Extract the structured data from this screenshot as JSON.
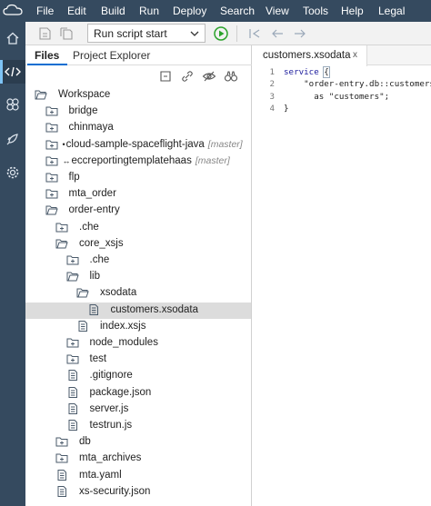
{
  "menu": [
    "File",
    "Edit",
    "Build",
    "Run",
    "Deploy",
    "Search",
    "View",
    "Tools",
    "Help",
    "Legal"
  ],
  "toolbar": {
    "run_config": "Run script start"
  },
  "panel": {
    "tabs": [
      "Files",
      "Project Explorer"
    ]
  },
  "tree": [
    {
      "label": "Workspace",
      "type": "folder-open",
      "depth": 0
    },
    {
      "label": "bridge",
      "type": "folder-pkg",
      "depth": 1
    },
    {
      "label": "chinmaya",
      "type": "folder-pkg",
      "depth": 1
    },
    {
      "label": "cloud-sample-spaceflight-java",
      "type": "folder-pkg",
      "depth": 1,
      "prefix": "•",
      "tag": "[master]"
    },
    {
      "label": "eccreportingtemplatehaas",
      "type": "folder-pkg",
      "depth": 1,
      "prefix": "↔",
      "tag": "[master]"
    },
    {
      "label": "flp",
      "type": "folder-pkg",
      "depth": 1
    },
    {
      "label": "mta_order",
      "type": "folder-pkg",
      "depth": 1
    },
    {
      "label": "order-entry",
      "type": "folder-open",
      "depth": 1
    },
    {
      "label": ".che",
      "type": "folder-pkg",
      "depth": 2
    },
    {
      "label": "core_xsjs",
      "type": "folder-open",
      "depth": 2
    },
    {
      "label": ".che",
      "type": "folder-pkg",
      "depth": 3
    },
    {
      "label": "lib",
      "type": "folder-open",
      "depth": 3
    },
    {
      "label": "xsodata",
      "type": "folder-open",
      "depth": 4
    },
    {
      "label": "customers.xsodata",
      "type": "file",
      "depth": 5,
      "selected": true
    },
    {
      "label": "index.xsjs",
      "type": "file",
      "depth": 4
    },
    {
      "label": "node_modules",
      "type": "folder-pkg",
      "depth": 3
    },
    {
      "label": "test",
      "type": "folder-pkg",
      "depth": 3
    },
    {
      "label": ".gitignore",
      "type": "file",
      "depth": 3
    },
    {
      "label": "package.json",
      "type": "file",
      "depth": 3
    },
    {
      "label": "server.js",
      "type": "file",
      "depth": 3
    },
    {
      "label": "testrun.js",
      "type": "file",
      "depth": 3
    },
    {
      "label": "db",
      "type": "folder-pkg",
      "depth": 2
    },
    {
      "label": "mta_archives",
      "type": "folder-pkg",
      "depth": 2
    },
    {
      "label": "mta.yaml",
      "type": "file",
      "depth": 2
    },
    {
      "label": "xs-security.json",
      "type": "file",
      "depth": 2
    }
  ],
  "editor": {
    "tab_title": "customers.xsodata",
    "tab_close": "x",
    "lines": [
      {
        "num": "1",
        "kw": "service ",
        "text": "{"
      },
      {
        "num": "2",
        "kw": "",
        "text": "    \"order-entry.db::customers\""
      },
      {
        "num": "3",
        "kw": "",
        "text": "      as \"customers\";"
      },
      {
        "num": "4",
        "kw": "",
        "text": "}"
      }
    ]
  },
  "colors": {
    "shell": "#354a5f",
    "accent": "#0a6ed1",
    "run_green": "#2ba32b"
  }
}
